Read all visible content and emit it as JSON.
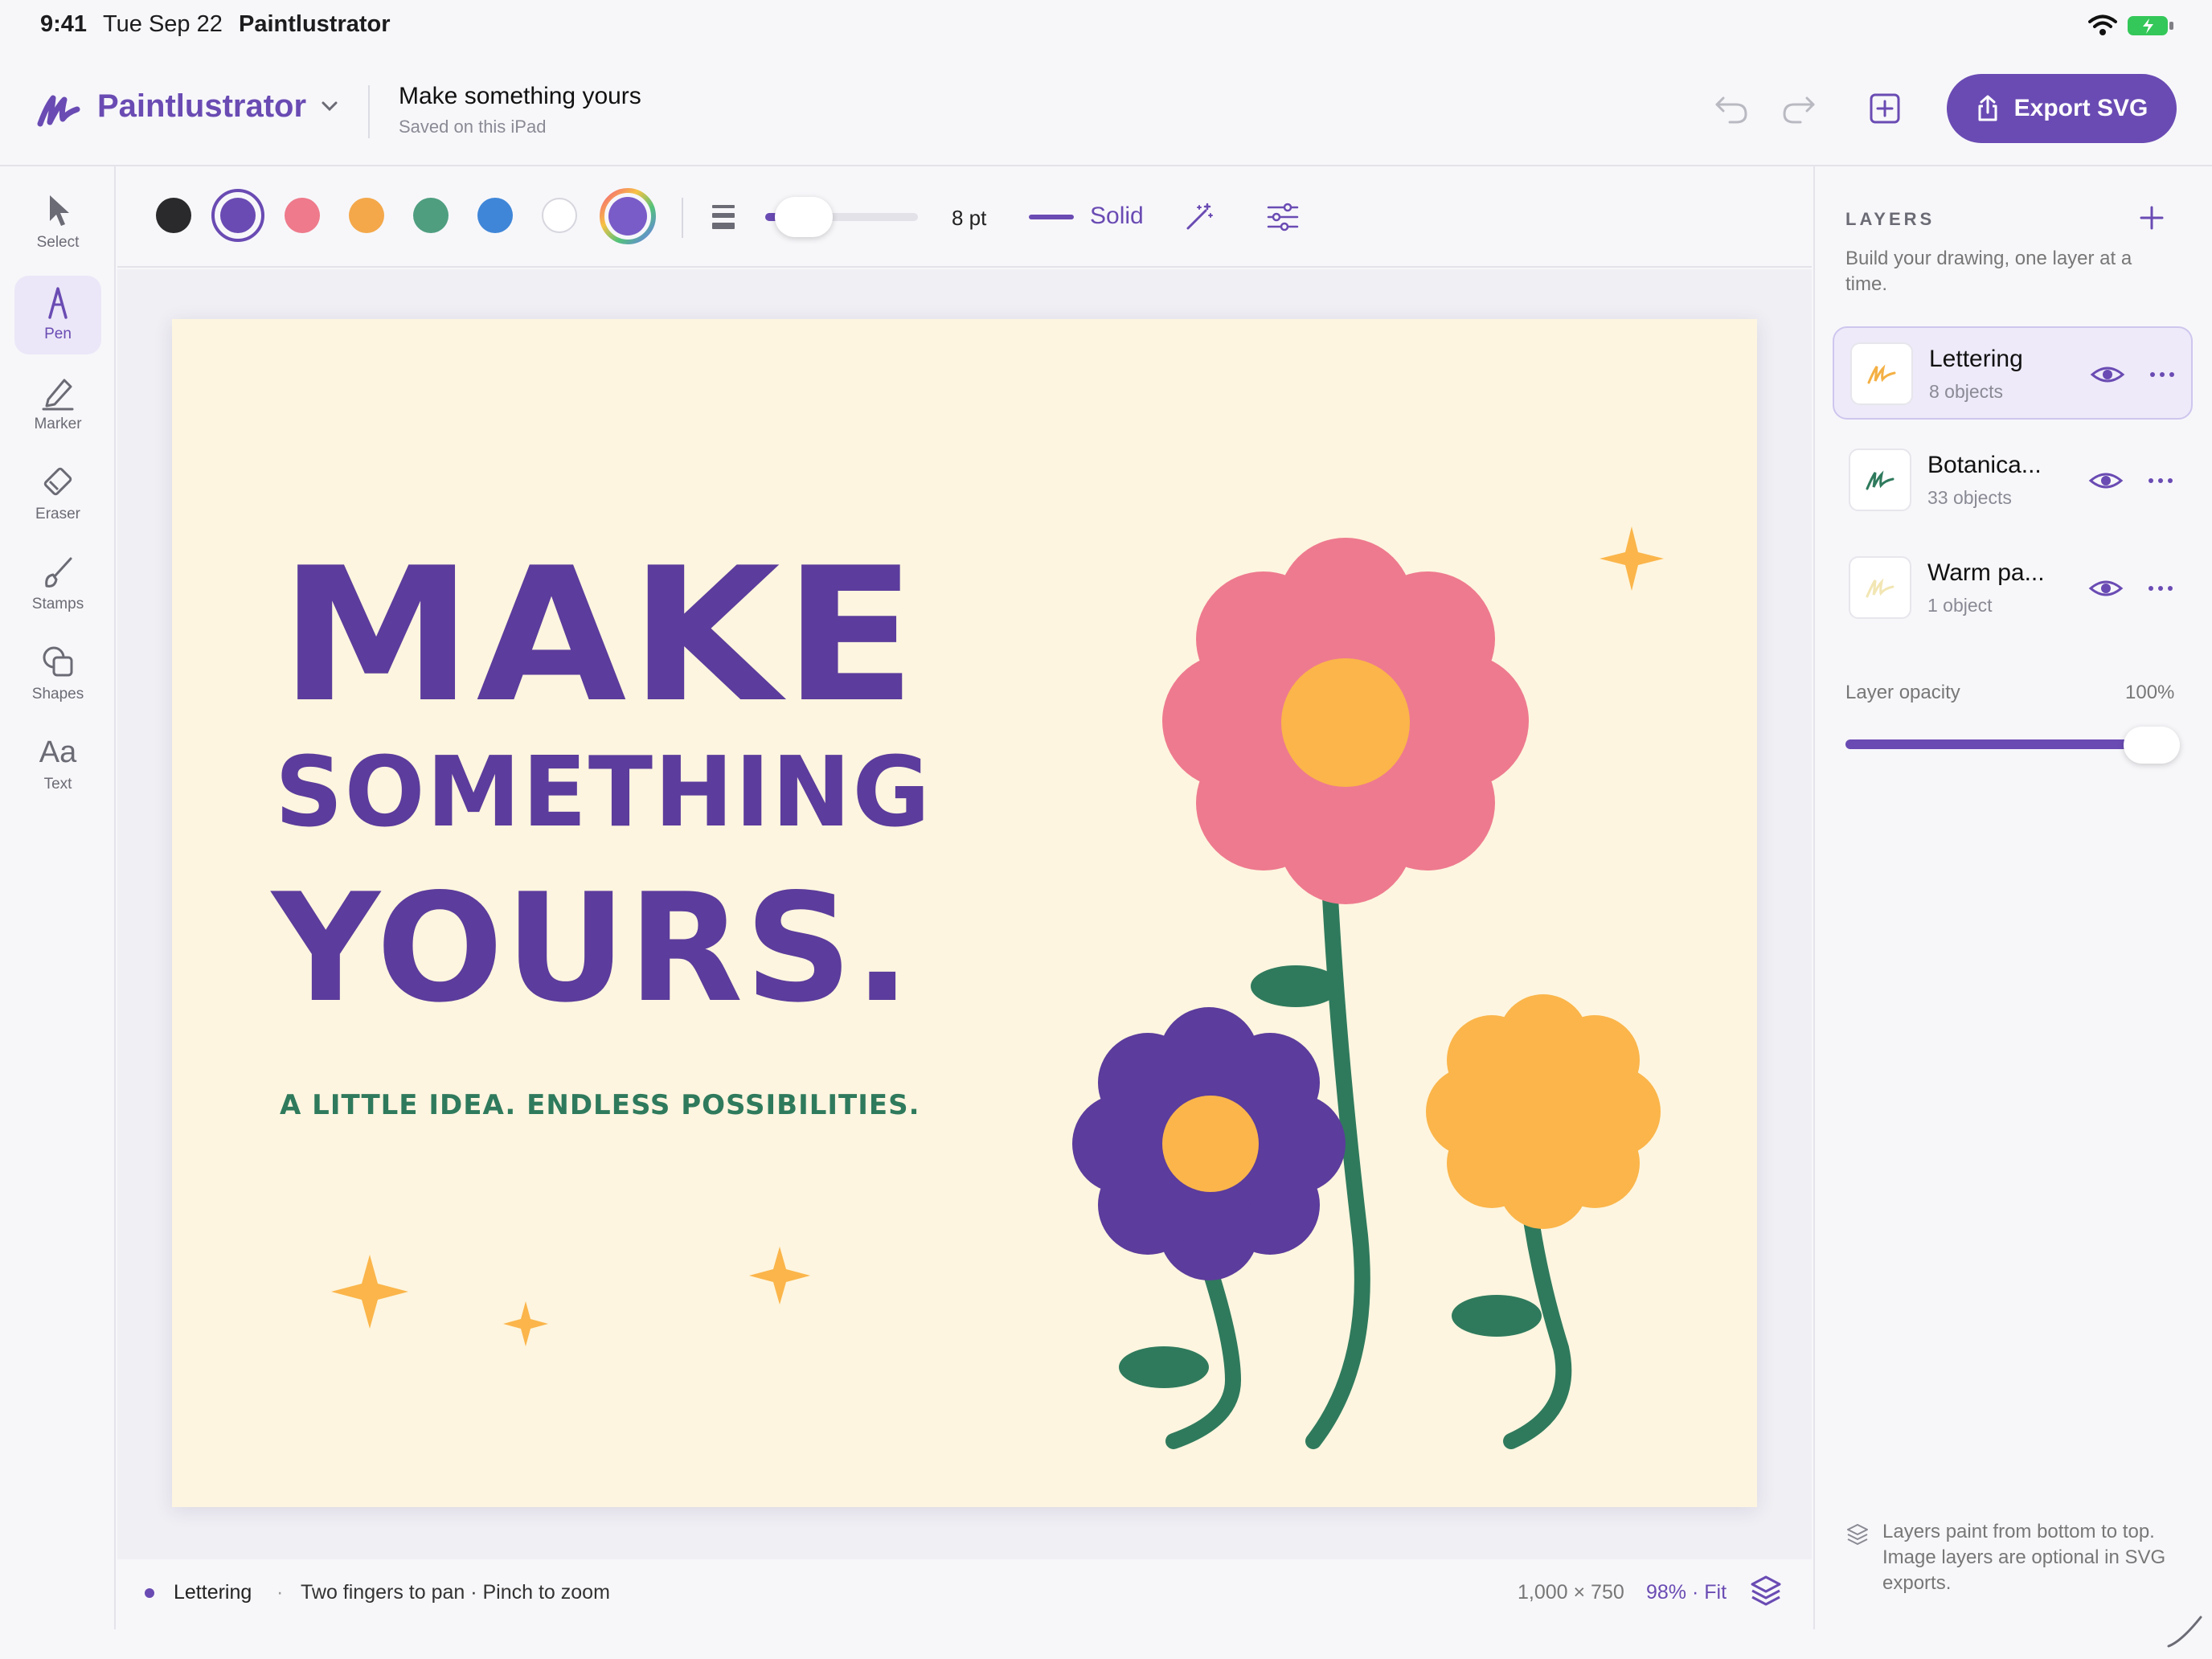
{
  "status_bar": {
    "time": "9:41",
    "date": "Tue Sep 22",
    "app": "Paintlustrator"
  },
  "header": {
    "app_name": "Paintlustrator",
    "doc_title": "Make something yours",
    "doc_subtitle": "Saved on this iPad",
    "export_label": "Export SVG"
  },
  "tools": [
    {
      "label": "Select",
      "icon": "cursor-icon"
    },
    {
      "label": "Pen",
      "icon": "pen-icon",
      "active": true
    },
    {
      "label": "Marker",
      "icon": "marker-icon"
    },
    {
      "label": "Eraser",
      "icon": "eraser-icon"
    },
    {
      "label": "Stamps",
      "icon": "brush-icon"
    },
    {
      "label": "Shapes",
      "icon": "shapes-icon"
    },
    {
      "label": "Text",
      "icon": "text-icon"
    }
  ],
  "options": {
    "colors": [
      "#2a2a2c",
      "#6a4bb3",
      "#ee7a8b",
      "#f4a84a",
      "#4f9e80",
      "#3f86d8",
      "#ffffff"
    ],
    "selected_color": "#6a4bb3",
    "size_value": "8 pt",
    "size_fraction": 0.2,
    "stroke_style": "Solid"
  },
  "artwork": {
    "line1": "MAKE",
    "line2": "SOMETHING",
    "line3": "YOURS.",
    "tagline": "A LITTLE IDEA. ENDLESS POSSIBILITIES.",
    "colors": {
      "background": "#fdf5df",
      "purple": "#5c3c9c",
      "pink": "#ee7a8f",
      "orange": "#fbb54a",
      "green": "#2f7a5d"
    }
  },
  "canvas_footer": {
    "active_layer": "Lettering",
    "separator": "·",
    "hint": "Two fingers to pan · Pinch to zoom",
    "dimensions": "1,000 × 750",
    "zoom": "98% · Fit"
  },
  "layers_panel": {
    "title": "LAYERS",
    "description": "Build your drawing, one layer at a time.",
    "layers": [
      {
        "name": "Lettering",
        "count": "8 objects",
        "selected": true,
        "thumb_color": "#f4b044"
      },
      {
        "name": "Botanica...",
        "count": "33 objects",
        "selected": false,
        "thumb_color": "#2f7a5d"
      },
      {
        "name": "Warm pa...",
        "count": "1 object",
        "selected": false,
        "thumb_color": "#f5e9b8"
      }
    ],
    "opacity_label": "Layer opacity",
    "opacity_value": "100%",
    "opacity_fraction": 1.0,
    "note": "Layers paint from bottom to top. Image layers are optional in SVG exports."
  }
}
